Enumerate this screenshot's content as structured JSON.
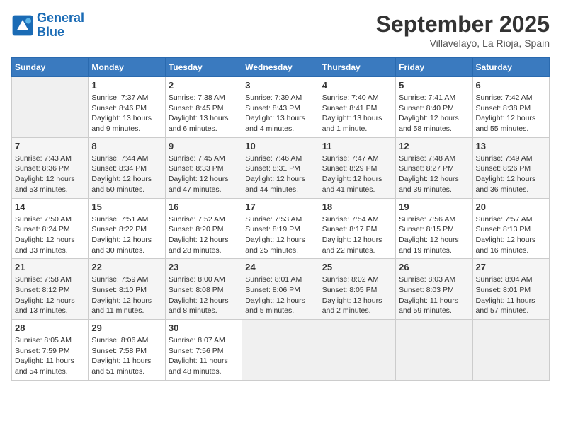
{
  "header": {
    "logo_line1": "General",
    "logo_line2": "Blue",
    "month": "September 2025",
    "location": "Villavelayo, La Rioja, Spain"
  },
  "weekdays": [
    "Sunday",
    "Monday",
    "Tuesday",
    "Wednesday",
    "Thursday",
    "Friday",
    "Saturday"
  ],
  "weeks": [
    [
      null,
      {
        "day": 1,
        "sunrise": "7:37 AM",
        "sunset": "8:46 PM",
        "daylight": "13 hours and 9 minutes."
      },
      {
        "day": 2,
        "sunrise": "7:38 AM",
        "sunset": "8:45 PM",
        "daylight": "13 hours and 6 minutes."
      },
      {
        "day": 3,
        "sunrise": "7:39 AM",
        "sunset": "8:43 PM",
        "daylight": "13 hours and 4 minutes."
      },
      {
        "day": 4,
        "sunrise": "7:40 AM",
        "sunset": "8:41 PM",
        "daylight": "13 hours and 1 minute."
      },
      {
        "day": 5,
        "sunrise": "7:41 AM",
        "sunset": "8:40 PM",
        "daylight": "12 hours and 58 minutes."
      },
      {
        "day": 6,
        "sunrise": "7:42 AM",
        "sunset": "8:38 PM",
        "daylight": "12 hours and 55 minutes."
      }
    ],
    [
      {
        "day": 7,
        "sunrise": "7:43 AM",
        "sunset": "8:36 PM",
        "daylight": "12 hours and 53 minutes."
      },
      {
        "day": 8,
        "sunrise": "7:44 AM",
        "sunset": "8:34 PM",
        "daylight": "12 hours and 50 minutes."
      },
      {
        "day": 9,
        "sunrise": "7:45 AM",
        "sunset": "8:33 PM",
        "daylight": "12 hours and 47 minutes."
      },
      {
        "day": 10,
        "sunrise": "7:46 AM",
        "sunset": "8:31 PM",
        "daylight": "12 hours and 44 minutes."
      },
      {
        "day": 11,
        "sunrise": "7:47 AM",
        "sunset": "8:29 PM",
        "daylight": "12 hours and 41 minutes."
      },
      {
        "day": 12,
        "sunrise": "7:48 AM",
        "sunset": "8:27 PM",
        "daylight": "12 hours and 39 minutes."
      },
      {
        "day": 13,
        "sunrise": "7:49 AM",
        "sunset": "8:26 PM",
        "daylight": "12 hours and 36 minutes."
      }
    ],
    [
      {
        "day": 14,
        "sunrise": "7:50 AM",
        "sunset": "8:24 PM",
        "daylight": "12 hours and 33 minutes."
      },
      {
        "day": 15,
        "sunrise": "7:51 AM",
        "sunset": "8:22 PM",
        "daylight": "12 hours and 30 minutes."
      },
      {
        "day": 16,
        "sunrise": "7:52 AM",
        "sunset": "8:20 PM",
        "daylight": "12 hours and 28 minutes."
      },
      {
        "day": 17,
        "sunrise": "7:53 AM",
        "sunset": "8:19 PM",
        "daylight": "12 hours and 25 minutes."
      },
      {
        "day": 18,
        "sunrise": "7:54 AM",
        "sunset": "8:17 PM",
        "daylight": "12 hours and 22 minutes."
      },
      {
        "day": 19,
        "sunrise": "7:56 AM",
        "sunset": "8:15 PM",
        "daylight": "12 hours and 19 minutes."
      },
      {
        "day": 20,
        "sunrise": "7:57 AM",
        "sunset": "8:13 PM",
        "daylight": "12 hours and 16 minutes."
      }
    ],
    [
      {
        "day": 21,
        "sunrise": "7:58 AM",
        "sunset": "8:12 PM",
        "daylight": "12 hours and 13 minutes."
      },
      {
        "day": 22,
        "sunrise": "7:59 AM",
        "sunset": "8:10 PM",
        "daylight": "12 hours and 11 minutes."
      },
      {
        "day": 23,
        "sunrise": "8:00 AM",
        "sunset": "8:08 PM",
        "daylight": "12 hours and 8 minutes."
      },
      {
        "day": 24,
        "sunrise": "8:01 AM",
        "sunset": "8:06 PM",
        "daylight": "12 hours and 5 minutes."
      },
      {
        "day": 25,
        "sunrise": "8:02 AM",
        "sunset": "8:05 PM",
        "daylight": "12 hours and 2 minutes."
      },
      {
        "day": 26,
        "sunrise": "8:03 AM",
        "sunset": "8:03 PM",
        "daylight": "11 hours and 59 minutes."
      },
      {
        "day": 27,
        "sunrise": "8:04 AM",
        "sunset": "8:01 PM",
        "daylight": "11 hours and 57 minutes."
      }
    ],
    [
      {
        "day": 28,
        "sunrise": "8:05 AM",
        "sunset": "7:59 PM",
        "daylight": "11 hours and 54 minutes."
      },
      {
        "day": 29,
        "sunrise": "8:06 AM",
        "sunset": "7:58 PM",
        "daylight": "11 hours and 51 minutes."
      },
      {
        "day": 30,
        "sunrise": "8:07 AM",
        "sunset": "7:56 PM",
        "daylight": "11 hours and 48 minutes."
      },
      null,
      null,
      null,
      null
    ]
  ]
}
